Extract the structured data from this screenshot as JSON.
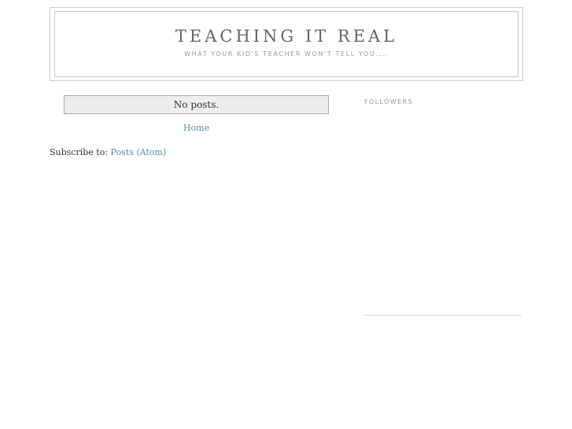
{
  "header": {
    "title": "TEACHING IT REAL",
    "description": "WHAT YOUR KID'S TEACHER WON'T TELL YOU...."
  },
  "main": {
    "status_message": "No posts.",
    "home_link": "Home",
    "subscribe_prefix": "Subscribe to:",
    "subscribe_link": "Posts (Atom)"
  },
  "sidebar": {
    "followers_heading": "FOLLOWERS"
  },
  "colors": {
    "link": "#5588aa",
    "status_bg": "#eeeeee",
    "border": "#cccccc"
  }
}
